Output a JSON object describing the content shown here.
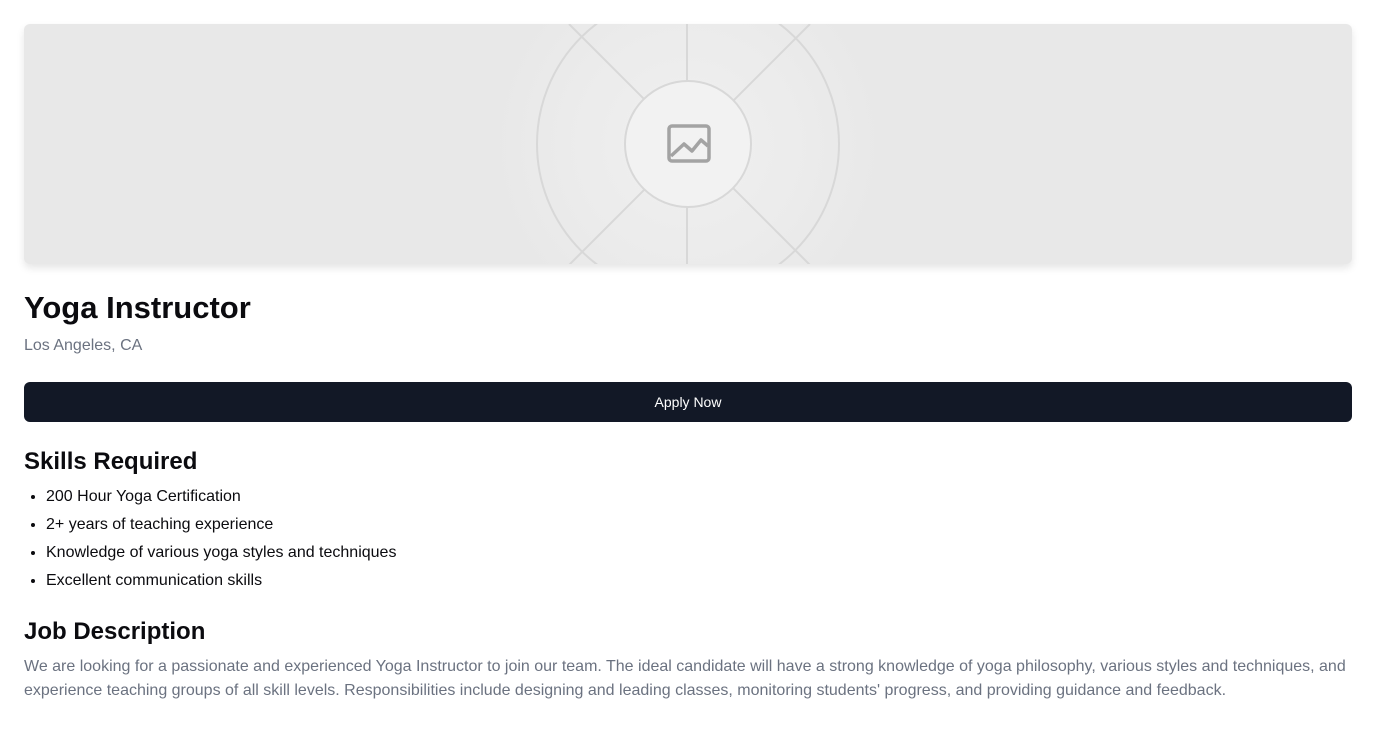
{
  "hero": {
    "icon": "image-placeholder-icon"
  },
  "job": {
    "title": "Yoga Instructor",
    "location": "Los Angeles, CA",
    "apply_label": "Apply Now"
  },
  "skills": {
    "heading": "Skills Required",
    "items": [
      "200 Hour Yoga Certification",
      "2+ years of teaching experience",
      "Knowledge of various yoga styles and techniques",
      "Excellent communication skills"
    ]
  },
  "description": {
    "heading": "Job Description",
    "text": "We are looking for a passionate and experienced Yoga Instructor to join our team. The ideal candidate will have a strong knowledge of yoga philosophy, various styles and techniques, and experience teaching groups of all skill levels. Responsibilities include designing and leading classes, monitoring students' progress, and providing guidance and feedback."
  },
  "colors": {
    "primary_button": "#121826",
    "muted_text": "#6b7280",
    "placeholder_bg": "#e8e8e8"
  }
}
